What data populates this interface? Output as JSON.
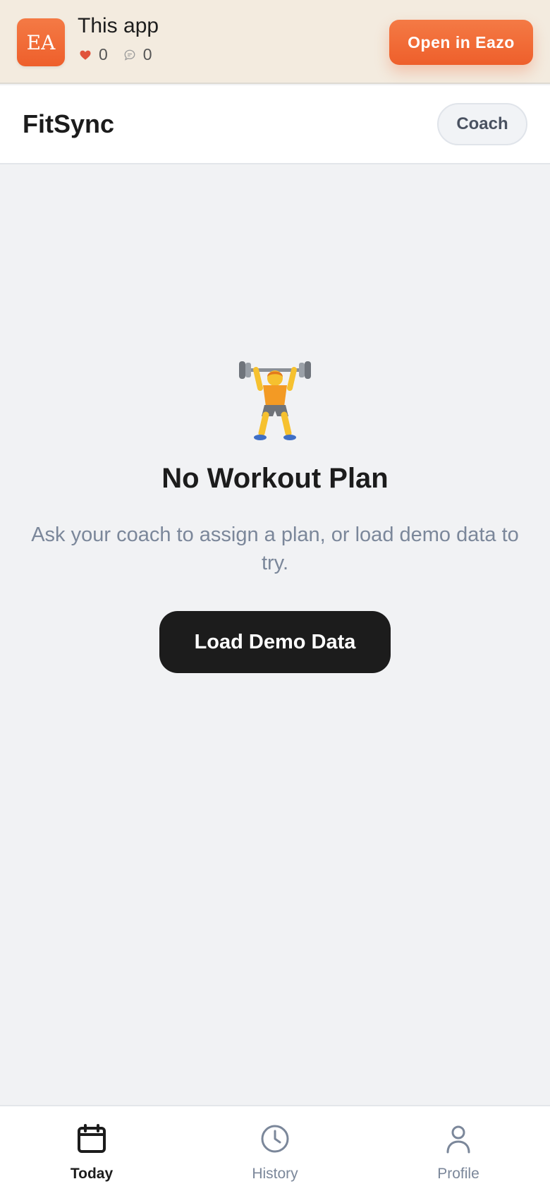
{
  "banner": {
    "logo_text": "EA",
    "app_name": "This app",
    "likes": "0",
    "comments": "0",
    "open_button": "Open in Eazo",
    "accent_color": "#ee5f2b"
  },
  "header": {
    "brand": "FitSync",
    "coach_button": "Coach"
  },
  "empty_state": {
    "icon": "weightlifter-icon",
    "title": "No Workout Plan",
    "description": "Ask your coach to assign a plan, or load demo data to try.",
    "button": "Load Demo Data"
  },
  "bottom_nav": {
    "items": [
      {
        "label": "Today",
        "icon": "calendar-icon",
        "active": true
      },
      {
        "label": "History",
        "icon": "clock-icon",
        "active": false
      },
      {
        "label": "Profile",
        "icon": "user-icon",
        "active": false
      }
    ]
  }
}
